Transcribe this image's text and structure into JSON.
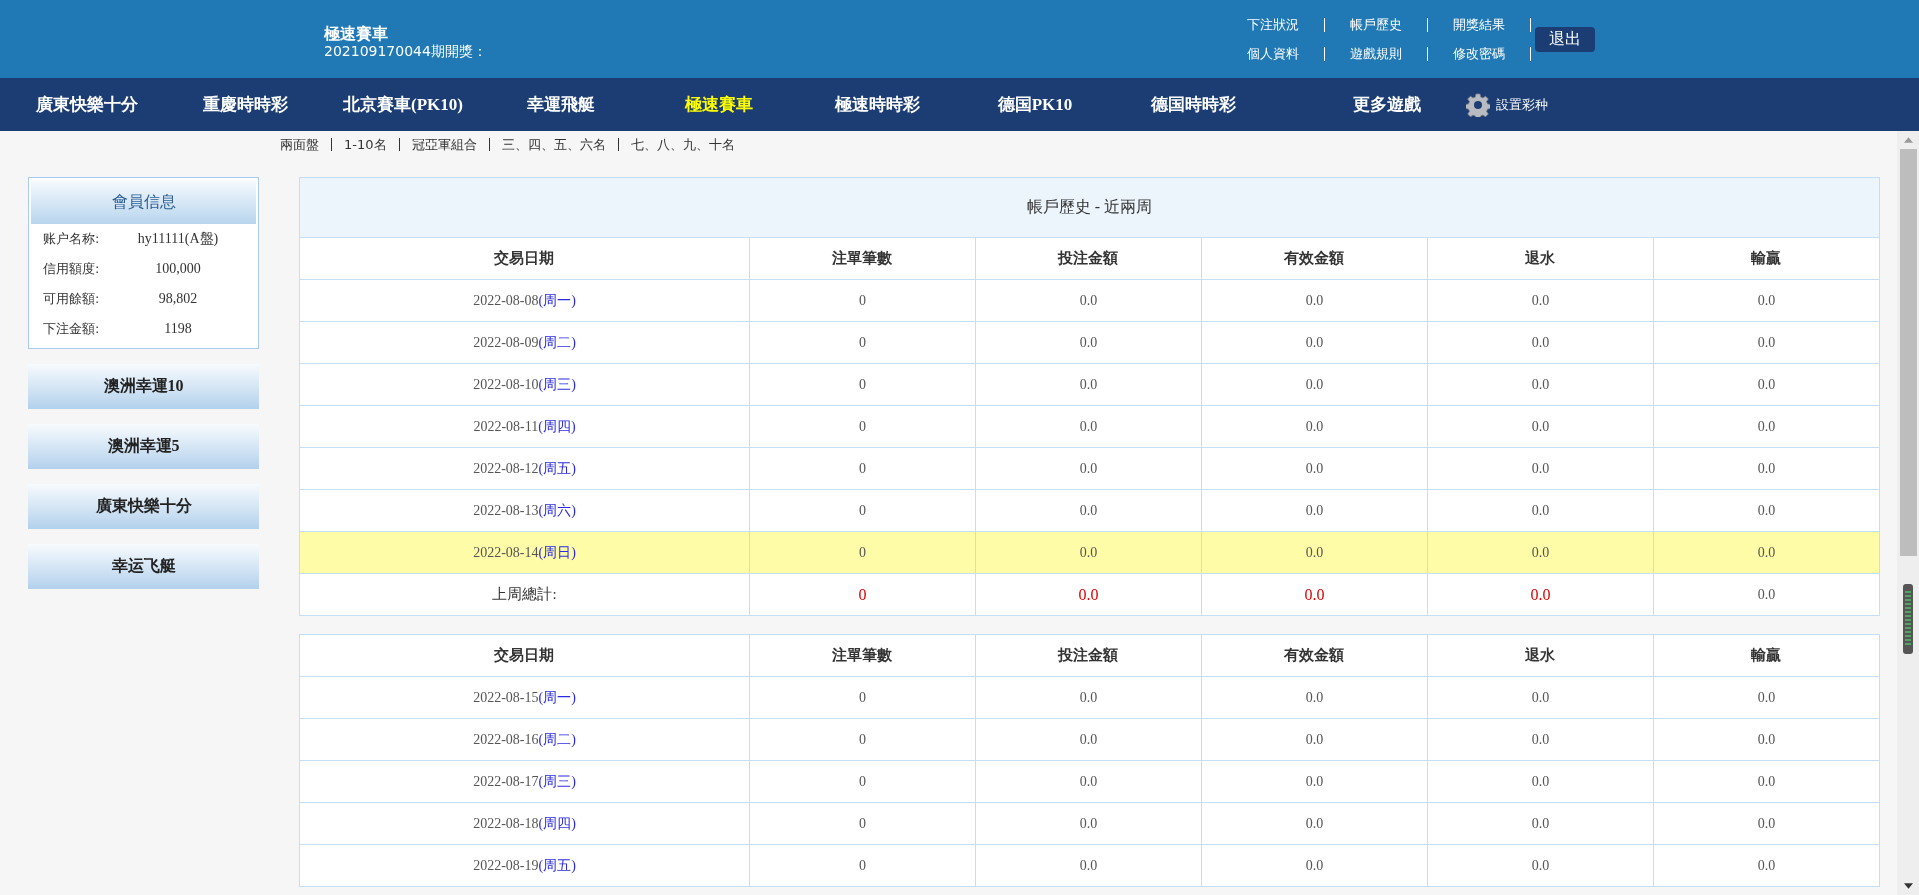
{
  "header": {
    "game_title": "極速賽車",
    "draw_info": "202109170044期開獎：",
    "links": [
      [
        "下注狀況",
        "帳戶歷史",
        "開獎結果"
      ],
      [
        "個人資料",
        "遊戲規則",
        "修改密碼"
      ]
    ],
    "logout": "退出"
  },
  "nav": {
    "items": [
      {
        "label": "廣東快樂十分",
        "selected": false
      },
      {
        "label": "重慶時時彩",
        "selected": false
      },
      {
        "label": "北京賽車(PK10)",
        "selected": false
      },
      {
        "label": "幸運飛艇",
        "selected": false
      },
      {
        "label": "極速賽車",
        "selected": true
      },
      {
        "label": "極速時時彩",
        "selected": false
      },
      {
        "label": "德国PK10",
        "selected": false
      },
      {
        "label": "德国時時彩",
        "selected": false
      },
      {
        "label": "更多遊戲",
        "selected": false
      }
    ],
    "settings": "設置彩种"
  },
  "subnav": [
    "兩面盤",
    "1-10名",
    "冠亞軍組合",
    "三、四、五、六名",
    "七、八、九、十名"
  ],
  "sidebar": {
    "member_title": "會員信息",
    "member_rows": [
      {
        "label": "账户名称:",
        "value": "hy11111(A盤)"
      },
      {
        "label": "信用額度:",
        "value": "100,000"
      },
      {
        "label": "可用餘額:",
        "value": "98,802"
      },
      {
        "label": "下注金額:",
        "value": "1198"
      }
    ],
    "games": [
      "澳洲幸運10",
      "澳洲幸運5",
      "廣東快樂十分",
      "幸运飞艇"
    ]
  },
  "tables": [
    {
      "title": "帳戶歷史 - 近兩周",
      "date_column": "交易日期",
      "columns": [
        "注單筆數",
        "投注金額",
        "有效金額",
        "退水",
        "輸贏"
      ],
      "rows": [
        {
          "date": "2022-08-08",
          "weekday": "(周一)",
          "cells": [
            "0",
            "0.0",
            "0.0",
            "0.0",
            "0.0"
          ],
          "highlighted": false
        },
        {
          "date": "2022-08-09",
          "weekday": "(周二)",
          "cells": [
            "0",
            "0.0",
            "0.0",
            "0.0",
            "0.0"
          ],
          "highlighted": false
        },
        {
          "date": "2022-08-10",
          "weekday": "(周三)",
          "cells": [
            "0",
            "0.0",
            "0.0",
            "0.0",
            "0.0"
          ],
          "highlighted": false
        },
        {
          "date": "2022-08-11",
          "weekday": "(周四)",
          "cells": [
            "0",
            "0.0",
            "0.0",
            "0.0",
            "0.0"
          ],
          "highlighted": false
        },
        {
          "date": "2022-08-12",
          "weekday": "(周五)",
          "cells": [
            "0",
            "0.0",
            "0.0",
            "0.0",
            "0.0"
          ],
          "highlighted": false
        },
        {
          "date": "2022-08-13",
          "weekday": "(周六)",
          "cells": [
            "0",
            "0.0",
            "0.0",
            "0.0",
            "0.0"
          ],
          "highlighted": false
        },
        {
          "date": "2022-08-14",
          "weekday": "(周日)",
          "cells": [
            "0",
            "0.0",
            "0.0",
            "0.0",
            "0.0"
          ],
          "highlighted": true
        }
      ],
      "total": {
        "label": "上周總計:",
        "cells": [
          {
            "text": "0",
            "emphasized": true
          },
          {
            "text": "0.0",
            "emphasized": true
          },
          {
            "text": "0.0",
            "emphasized": true
          },
          {
            "text": "0.0",
            "emphasized": true
          },
          {
            "text": "0.0",
            "emphasized": false
          }
        ]
      }
    },
    {
      "date_column": "交易日期",
      "columns": [
        "注單筆數",
        "投注金額",
        "有效金額",
        "退水",
        "輸贏"
      ],
      "rows": [
        {
          "date": "2022-08-15",
          "weekday": "(周一)",
          "cells": [
            "0",
            "0.0",
            "0.0",
            "0.0",
            "0.0"
          ],
          "highlighted": false
        },
        {
          "date": "2022-08-16",
          "weekday": "(周二)",
          "cells": [
            "0",
            "0.0",
            "0.0",
            "0.0",
            "0.0"
          ],
          "highlighted": false
        },
        {
          "date": "2022-08-17",
          "weekday": "(周三)",
          "cells": [
            "0",
            "0.0",
            "0.0",
            "0.0",
            "0.0"
          ],
          "highlighted": false
        },
        {
          "date": "2022-08-18",
          "weekday": "(周四)",
          "cells": [
            "0",
            "0.0",
            "0.0",
            "0.0",
            "0.0"
          ],
          "highlighted": false
        },
        {
          "date": "2022-08-19",
          "weekday": "(周五)",
          "cells": [
            "0",
            "0.0",
            "0.0",
            "0.0",
            "0.0"
          ],
          "highlighted": false
        }
      ]
    }
  ]
}
